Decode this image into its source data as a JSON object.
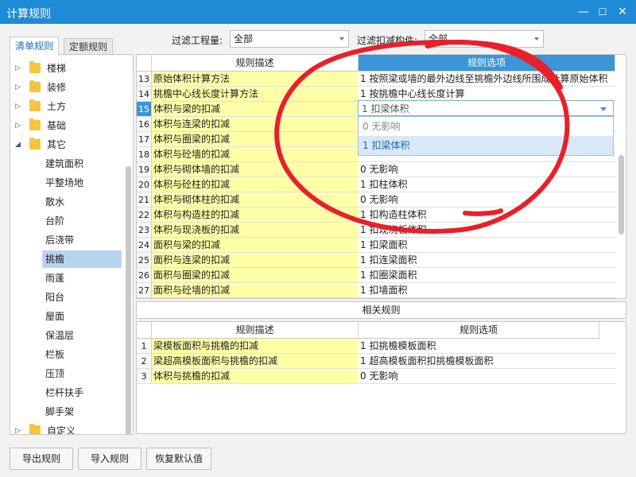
{
  "window": {
    "title": "计算规则",
    "min": "—",
    "max": "☐",
    "close": "✕"
  },
  "tabs": [
    "清单规则",
    "定额规则"
  ],
  "tree": [
    {
      "label": "楼梯",
      "arrow": "▷",
      "folder": true
    },
    {
      "label": "装修",
      "arrow": "▷",
      "folder": true
    },
    {
      "label": "土方",
      "arrow": "▷",
      "folder": true
    },
    {
      "label": "基础",
      "arrow": "▷",
      "folder": true
    },
    {
      "label": "其它",
      "arrow": "◢",
      "folder": true
    },
    {
      "label": "建筑面积",
      "child": true
    },
    {
      "label": "平整场地",
      "child": true
    },
    {
      "label": "散水",
      "child": true
    },
    {
      "label": "台阶",
      "child": true
    },
    {
      "label": "后浇带",
      "child": true
    },
    {
      "label": "挑檐",
      "child": true,
      "selected": true
    },
    {
      "label": "雨蓬",
      "child": true
    },
    {
      "label": "阳台",
      "child": true
    },
    {
      "label": "屋面",
      "child": true
    },
    {
      "label": "保温层",
      "child": true
    },
    {
      "label": "栏板",
      "child": true
    },
    {
      "label": "压顶",
      "child": true
    },
    {
      "label": "栏杆扶手",
      "child": true
    },
    {
      "label": "脚手架",
      "child": true
    },
    {
      "label": "自定义",
      "arrow": "▷",
      "folder": true
    }
  ],
  "filters": {
    "quantity_label": "过滤工程量:",
    "quantity_value": "全部",
    "component_label": "过滤扣减构件:",
    "component_value": "全部"
  },
  "grid": {
    "header_desc": "规则描述",
    "header_opt": "规则选项",
    "rows": [
      {
        "n": "13",
        "desc": "原始体积计算方法",
        "opt": "1 按照梁或墙的最外边线至挑檐外边线所围成计算原始体积"
      },
      {
        "n": "14",
        "desc": "挑檐中心线长度计算方法",
        "opt": "1  按挑檐中心线长度计算"
      },
      {
        "n": "15",
        "desc": "体积与梁的扣减",
        "opt": "",
        "current": true
      },
      {
        "n": "16",
        "desc": "体积与连梁的扣减",
        "opt": ""
      },
      {
        "n": "17",
        "desc": "体积与圈梁的扣减",
        "opt": ""
      },
      {
        "n": "18",
        "desc": "体积与砼墙的扣减",
        "opt": ""
      },
      {
        "n": "19",
        "desc": "体积与砌体墙的扣减",
        "opt": "0  无影响"
      },
      {
        "n": "20",
        "desc": "体积与砼柱的扣减",
        "opt": "1 扣柱体积"
      },
      {
        "n": "21",
        "desc": "体积与砌体柱的扣减",
        "opt": "0  无影响"
      },
      {
        "n": "22",
        "desc": "体积与构造柱的扣减",
        "opt": "1 扣构造柱体积"
      },
      {
        "n": "23",
        "desc": "体积与现浇板的扣减",
        "opt": "1 扣现浇板体积"
      },
      {
        "n": "24",
        "desc": "面积与梁的扣减",
        "opt": "1 扣梁面积"
      },
      {
        "n": "25",
        "desc": "面积与连梁的扣减",
        "opt": "1 扣连梁面积"
      },
      {
        "n": "26",
        "desc": "面积与圈梁的扣减",
        "opt": "1 扣圈梁面积"
      },
      {
        "n": "27",
        "desc": "面积与砼墙的扣减",
        "opt": "1 扣墙面积"
      }
    ],
    "editor_value": "1 扣梁体积",
    "dropdown": [
      "0  无影响",
      "1 扣梁体积"
    ]
  },
  "related": {
    "title": "相关规则",
    "header_desc": "规则描述",
    "header_opt": "规则选项",
    "rows": [
      {
        "n": "1",
        "desc": "梁模板面积与挑檐的扣减",
        "opt": "1 扣挑檐模板面积"
      },
      {
        "n": "2",
        "desc": "梁超高模板面积与挑檐的扣减",
        "opt": "1 超高模板面积扣挑檐模板面积"
      },
      {
        "n": "3",
        "desc": "体积与挑檐的扣减",
        "opt": "0  无影响"
      }
    ]
  },
  "buttons": {
    "export": "导出规则",
    "import": "导入规则",
    "restore": "恢复默认值"
  },
  "colors": {
    "titlebar": "#1f8ad6",
    "desc_cell": "#ffffa8",
    "selection": "#b8d3f0",
    "scribble": "#e8202a",
    "row_current": "#3b95d9"
  }
}
